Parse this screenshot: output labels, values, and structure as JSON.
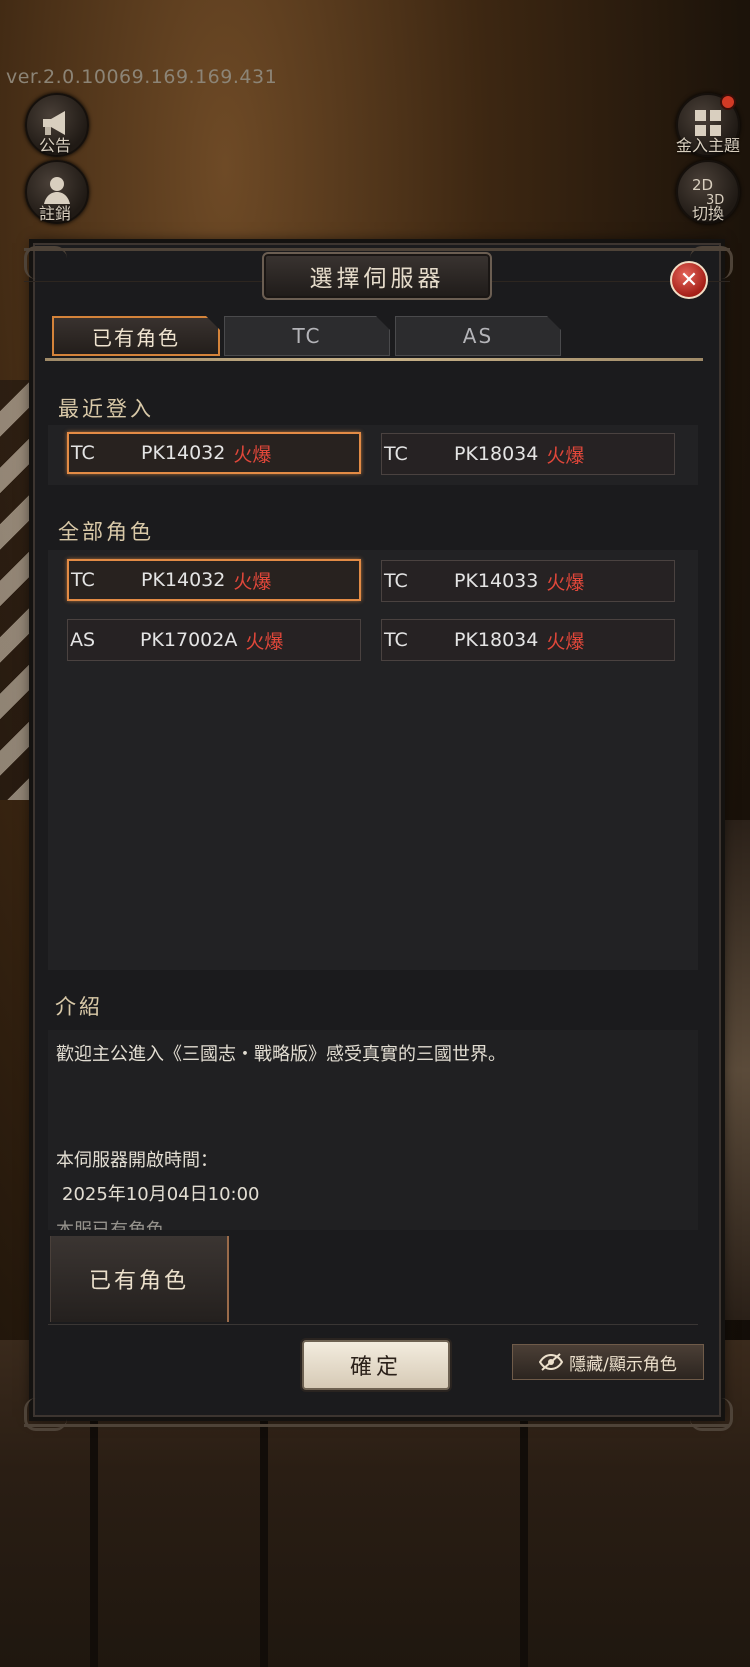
{
  "version": "ver.2.0.10069.169.169.431",
  "side_buttons": {
    "notice": "公告",
    "logout": "註銷",
    "main_menu": "金入主題",
    "view_switch": "切換",
    "view_switch_icon_top": "2D",
    "view_switch_icon_bottom": "3D"
  },
  "dialog": {
    "title": "選擇伺服器",
    "close_symbol": "✕"
  },
  "tabs": [
    {
      "label": "已有角色",
      "active": true
    },
    {
      "label": "TC",
      "active": false
    },
    {
      "label": "AS",
      "active": false
    }
  ],
  "recent": {
    "title": "最近登入",
    "servers": [
      {
        "region": "TC",
        "id": "PK14032",
        "status": "火爆",
        "selected": true
      },
      {
        "region": "TC",
        "id": "PK18034",
        "status": "火爆",
        "selected": false
      }
    ]
  },
  "all_roles": {
    "title": "全部角色",
    "servers": [
      {
        "region": "TC",
        "id": "PK14032",
        "status": "火爆",
        "selected": true
      },
      {
        "region": "TC",
        "id": "PK14033",
        "status": "火爆",
        "selected": false
      },
      {
        "region": "AS",
        "id": "PK17002A",
        "status": "火爆",
        "selected": false
      },
      {
        "region": "TC",
        "id": "PK18034",
        "status": "火爆",
        "selected": false
      }
    ]
  },
  "intro": {
    "title": "介紹",
    "welcome": "歡迎主公進入《三國志・戰略版》感受真實的三國世界。",
    "open_time_label": "本伺服器開啟時間：",
    "open_time": "2025年10月04日10:00",
    "cut_line": "本服已有角色"
  },
  "bottom_tab": "已有角色",
  "confirm": "確定",
  "toggle_roles": "隱藏/顯示角色",
  "colors": {
    "accent_orange": "#e38b45",
    "hot_red": "#e0473a",
    "gold_text": "#d9c9a8"
  }
}
